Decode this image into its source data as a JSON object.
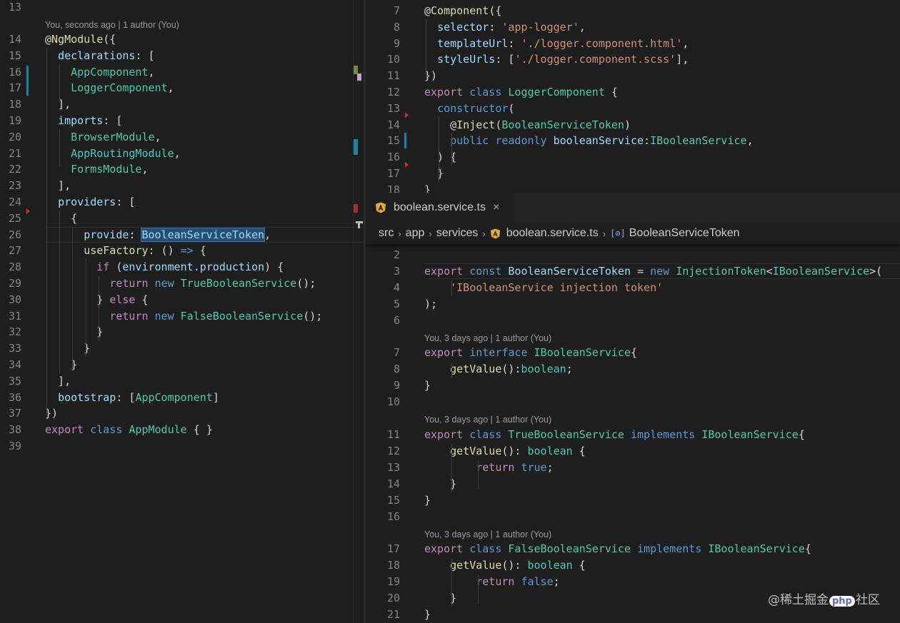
{
  "left_editor": {
    "codelens": "You, seconds ago | 1 author (You)",
    "lines": [
      {
        "n": "13",
        "tokens": []
      },
      {
        "n": "14",
        "tokens": [
          [
            "p",
            "@"
          ],
          [
            "dec",
            "NgModule"
          ],
          [
            "p",
            "({"
          ]
        ]
      },
      {
        "n": "15",
        "tokens": [
          [
            "p",
            "  "
          ],
          [
            "prop",
            "declarations"
          ],
          [
            "p",
            ": ["
          ]
        ]
      },
      {
        "n": "16",
        "tokens": [
          [
            "p",
            "    "
          ],
          [
            "type",
            "AppComponent"
          ],
          [
            "p",
            ","
          ]
        ]
      },
      {
        "n": "17",
        "tokens": [
          [
            "p",
            "    "
          ],
          [
            "type",
            "LoggerComponent"
          ],
          [
            "p",
            ","
          ]
        ]
      },
      {
        "n": "18",
        "tokens": [
          [
            "p",
            "  ],"
          ]
        ]
      },
      {
        "n": "19",
        "tokens": [
          [
            "p",
            "  "
          ],
          [
            "prop",
            "imports"
          ],
          [
            "p",
            ": ["
          ]
        ]
      },
      {
        "n": "20",
        "tokens": [
          [
            "p",
            "    "
          ],
          [
            "type",
            "BrowserModule"
          ],
          [
            "p",
            ","
          ]
        ]
      },
      {
        "n": "21",
        "tokens": [
          [
            "p",
            "    "
          ],
          [
            "type",
            "AppRoutingModule"
          ],
          [
            "p",
            ","
          ]
        ]
      },
      {
        "n": "22",
        "tokens": [
          [
            "p",
            "    "
          ],
          [
            "type",
            "FormsModule"
          ],
          [
            "p",
            ","
          ]
        ]
      },
      {
        "n": "23",
        "tokens": [
          [
            "p",
            "  ],"
          ]
        ]
      },
      {
        "n": "24",
        "tokens": [
          [
            "p",
            "  "
          ],
          [
            "prop",
            "providers"
          ],
          [
            "p",
            ": ["
          ]
        ]
      },
      {
        "n": "25",
        "tokens": [
          [
            "p",
            "    {"
          ]
        ]
      },
      {
        "n": "26",
        "tokens": [
          [
            "p",
            "      "
          ],
          [
            "prop",
            "provide"
          ],
          [
            "p",
            ": "
          ],
          [
            "sel",
            "BooleanServiceToken"
          ],
          [
            "p",
            ","
          ]
        ]
      },
      {
        "n": "27",
        "tokens": [
          [
            "p",
            "      "
          ],
          [
            "fn",
            "useFactory"
          ],
          [
            "p",
            ": () "
          ],
          [
            "kw",
            "=>"
          ],
          [
            "p",
            " {"
          ]
        ]
      },
      {
        "n": "28",
        "tokens": [
          [
            "p",
            "        "
          ],
          [
            "ctl",
            "if"
          ],
          [
            "p",
            " ("
          ],
          [
            "prop",
            "environment"
          ],
          [
            "p",
            "."
          ],
          [
            "prop",
            "production"
          ],
          [
            "p",
            ") {"
          ]
        ]
      },
      {
        "n": "29",
        "tokens": [
          [
            "p",
            "          "
          ],
          [
            "ctl",
            "return"
          ],
          [
            "p",
            " "
          ],
          [
            "kw",
            "new"
          ],
          [
            "p",
            " "
          ],
          [
            "type",
            "TrueBooleanService"
          ],
          [
            "p",
            "();"
          ]
        ]
      },
      {
        "n": "30",
        "tokens": [
          [
            "p",
            "        } "
          ],
          [
            "ctl",
            "else"
          ],
          [
            "p",
            " {"
          ]
        ]
      },
      {
        "n": "31",
        "tokens": [
          [
            "p",
            "          "
          ],
          [
            "ctl",
            "return"
          ],
          [
            "p",
            " "
          ],
          [
            "kw",
            "new"
          ],
          [
            "p",
            " "
          ],
          [
            "type",
            "FalseBooleanService"
          ],
          [
            "p",
            "();"
          ]
        ]
      },
      {
        "n": "32",
        "tokens": [
          [
            "p",
            "        }"
          ]
        ]
      },
      {
        "n": "33",
        "tokens": [
          [
            "p",
            "      }"
          ]
        ]
      },
      {
        "n": "34",
        "tokens": [
          [
            "p",
            "    }"
          ]
        ]
      },
      {
        "n": "35",
        "tokens": [
          [
            "p",
            "  ],"
          ]
        ]
      },
      {
        "n": "36",
        "tokens": [
          [
            "p",
            "  "
          ],
          [
            "prop",
            "bootstrap"
          ],
          [
            "p",
            ": ["
          ],
          [
            "type",
            "AppComponent"
          ],
          [
            "p",
            "]"
          ]
        ]
      },
      {
        "n": "37",
        "tokens": [
          [
            "p",
            "})"
          ]
        ]
      },
      {
        "n": "38",
        "tokens": [
          [
            "ctl",
            "export"
          ],
          [
            "p",
            " "
          ],
          [
            "kw",
            "class"
          ],
          [
            "p",
            " "
          ],
          [
            "type",
            "AppModule"
          ],
          [
            "p",
            " { }"
          ]
        ]
      },
      {
        "n": "39",
        "tokens": []
      }
    ]
  },
  "right_top_editor": {
    "lines": [
      {
        "n": "7",
        "tokens": [
          [
            "p",
            "@"
          ],
          [
            "dec",
            "Component"
          ],
          [
            "p",
            "({"
          ]
        ]
      },
      {
        "n": "8",
        "tokens": [
          [
            "p",
            "  "
          ],
          [
            "prop",
            "selector"
          ],
          [
            "p",
            ": "
          ],
          [
            "str",
            "'app-logger'"
          ],
          [
            "p",
            ","
          ]
        ]
      },
      {
        "n": "9",
        "tokens": [
          [
            "p",
            "  "
          ],
          [
            "prop",
            "templateUrl"
          ],
          [
            "p",
            ": "
          ],
          [
            "str",
            "'./logger.component.html'"
          ],
          [
            "p",
            ","
          ]
        ]
      },
      {
        "n": "10",
        "tokens": [
          [
            "p",
            "  "
          ],
          [
            "prop",
            "styleUrls"
          ],
          [
            "p",
            ": ["
          ],
          [
            "str",
            "'./logger.component.scss'"
          ],
          [
            "p",
            "],"
          ]
        ]
      },
      {
        "n": "11",
        "tokens": [
          [
            "p",
            "})"
          ]
        ]
      },
      {
        "n": "12",
        "tokens": [
          [
            "ctl",
            "export"
          ],
          [
            "p",
            " "
          ],
          [
            "kw",
            "class"
          ],
          [
            "p",
            " "
          ],
          [
            "type",
            "LoggerComponent"
          ],
          [
            "p",
            " {"
          ]
        ]
      },
      {
        "n": "13",
        "tokens": [
          [
            "p",
            "  "
          ],
          [
            "kw",
            "constructor"
          ],
          [
            "p",
            "("
          ]
        ]
      },
      {
        "n": "14",
        "tokens": [
          [
            "p",
            "    @"
          ],
          [
            "dec",
            "Inject"
          ],
          [
            "p",
            "("
          ],
          [
            "type",
            "BooleanServiceToken"
          ],
          [
            "p",
            ")"
          ]
        ]
      },
      {
        "n": "15",
        "tokens": [
          [
            "p",
            "    "
          ],
          [
            "kw",
            "public"
          ],
          [
            "p",
            " "
          ],
          [
            "kw",
            "readonly"
          ],
          [
            "p",
            " "
          ],
          [
            "prop",
            "booleanService"
          ],
          [
            "p",
            ":"
          ],
          [
            "type",
            "IBooleanService"
          ],
          [
            "p",
            ","
          ]
        ]
      },
      {
        "n": "16",
        "tokens": [
          [
            "p",
            "  ) {"
          ]
        ]
      },
      {
        "n": "17",
        "tokens": [
          [
            "p",
            "  }"
          ]
        ]
      },
      {
        "n": "18",
        "tokens": [
          [
            "p",
            "}"
          ]
        ]
      }
    ]
  },
  "tab": {
    "label": "boolean.service.ts",
    "close": "×",
    "icon": "angular-icon"
  },
  "breadcrumb": {
    "parts": [
      "src",
      "app",
      "services",
      "boolean.service.ts",
      "BooleanServiceToken"
    ],
    "separator": "›",
    "symbol_glyph": "[⊘]"
  },
  "right_bottom_editor": {
    "codelens": "You, 3 days ago | 1 author (You)",
    "lines": [
      {
        "n": "2",
        "tokens": []
      },
      {
        "n": "3",
        "tokens": [
          [
            "ctl",
            "export"
          ],
          [
            "p",
            " "
          ],
          [
            "kw",
            "const"
          ],
          [
            "p",
            " "
          ],
          [
            "type2",
            "BooleanServiceToken"
          ],
          [
            "p",
            " = "
          ],
          [
            "kw",
            "new"
          ],
          [
            "p",
            " "
          ],
          [
            "type",
            "InjectionToken"
          ],
          [
            "p",
            "<"
          ],
          [
            "type",
            "IBooleanService"
          ],
          [
            "p",
            ">("
          ]
        ]
      },
      {
        "n": "4",
        "tokens": [
          [
            "p",
            "    "
          ],
          [
            "str",
            "'IBooleanService injection token'"
          ]
        ]
      },
      {
        "n": "5",
        "tokens": [
          [
            "p",
            ");"
          ]
        ]
      },
      {
        "n": "6",
        "tokens": []
      },
      {
        "n": "7",
        "tokens": [
          [
            "ctl",
            "export"
          ],
          [
            "p",
            " "
          ],
          [
            "kw",
            "interface"
          ],
          [
            "p",
            " "
          ],
          [
            "type",
            "IBooleanService"
          ],
          [
            "p",
            "{"
          ]
        ]
      },
      {
        "n": "8",
        "tokens": [
          [
            "p",
            "    "
          ],
          [
            "fn",
            "getValue"
          ],
          [
            "p",
            "():"
          ],
          [
            "type",
            "boolean"
          ],
          [
            "p",
            ";"
          ]
        ]
      },
      {
        "n": "9",
        "tokens": [
          [
            "p",
            "}"
          ]
        ]
      },
      {
        "n": "10",
        "tokens": []
      },
      {
        "n": "11",
        "tokens": [
          [
            "ctl",
            "export"
          ],
          [
            "p",
            " "
          ],
          [
            "kw",
            "class"
          ],
          [
            "p",
            " "
          ],
          [
            "type",
            "TrueBooleanService"
          ],
          [
            "p",
            " "
          ],
          [
            "kw",
            "implements"
          ],
          [
            "p",
            " "
          ],
          [
            "type",
            "IBooleanService"
          ],
          [
            "p",
            "{"
          ]
        ]
      },
      {
        "n": "12",
        "tokens": [
          [
            "p",
            "    "
          ],
          [
            "fn",
            "getValue"
          ],
          [
            "p",
            "(): "
          ],
          [
            "type",
            "boolean"
          ],
          [
            "p",
            " {"
          ]
        ]
      },
      {
        "n": "13",
        "tokens": [
          [
            "p",
            "        "
          ],
          [
            "ctl",
            "return"
          ],
          [
            "p",
            " "
          ],
          [
            "kw",
            "true"
          ],
          [
            "p",
            ";"
          ]
        ]
      },
      {
        "n": "14",
        "tokens": [
          [
            "p",
            "    }"
          ]
        ]
      },
      {
        "n": "15",
        "tokens": [
          [
            "p",
            "}"
          ]
        ]
      },
      {
        "n": "16",
        "tokens": []
      },
      {
        "n": "17",
        "tokens": [
          [
            "ctl",
            "export"
          ],
          [
            "p",
            " "
          ],
          [
            "kw",
            "class"
          ],
          [
            "p",
            " "
          ],
          [
            "type",
            "FalseBooleanService"
          ],
          [
            "p",
            " "
          ],
          [
            "kw",
            "implements"
          ],
          [
            "p",
            " "
          ],
          [
            "type",
            "IBooleanService"
          ],
          [
            "p",
            "{"
          ]
        ]
      },
      {
        "n": "18",
        "tokens": [
          [
            "p",
            "    "
          ],
          [
            "fn",
            "getValue"
          ],
          [
            "p",
            "(): "
          ],
          [
            "type",
            "boolean"
          ],
          [
            "p",
            " {"
          ]
        ]
      },
      {
        "n": "19",
        "tokens": [
          [
            "p",
            "        "
          ],
          [
            "ctl",
            "return"
          ],
          [
            "p",
            " "
          ],
          [
            "kw",
            "false"
          ],
          [
            "p",
            ";"
          ]
        ]
      },
      {
        "n": "20",
        "tokens": [
          [
            "p",
            "    }"
          ]
        ]
      },
      {
        "n": "21",
        "tokens": [
          [
            "p",
            "}"
          ]
        ]
      }
    ]
  },
  "watermark": {
    "prefix": "@稀土掘金",
    "php": "php",
    "suffix": "社区"
  },
  "colors": {
    "background": "#1e1e1e",
    "keyword": "#569cd6",
    "control": "#c586c0",
    "property": "#9cdcfe",
    "type": "#4ec9b0",
    "string": "#ce9178",
    "function": "#dcdcaa",
    "git_modified": "#1b81a8",
    "breakpoint_marker": "#c72e2e"
  }
}
